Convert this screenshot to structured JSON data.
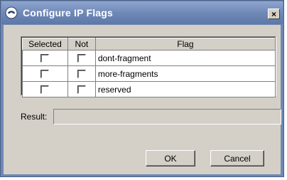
{
  "window": {
    "title": "Configure IP Flags",
    "close_glyph": "×",
    "icon": "app-logo-icon"
  },
  "table": {
    "columns": [
      "Selected",
      "Not",
      "Flag"
    ],
    "rows": [
      {
        "flag": "dont-fragment",
        "selected": false,
        "not": false
      },
      {
        "flag": "more-fragments",
        "selected": false,
        "not": false
      },
      {
        "flag": "reserved",
        "selected": false,
        "not": false
      }
    ]
  },
  "result": {
    "label": "Result:",
    "value": ""
  },
  "buttons": {
    "ok": "OK",
    "cancel": "Cancel"
  }
}
